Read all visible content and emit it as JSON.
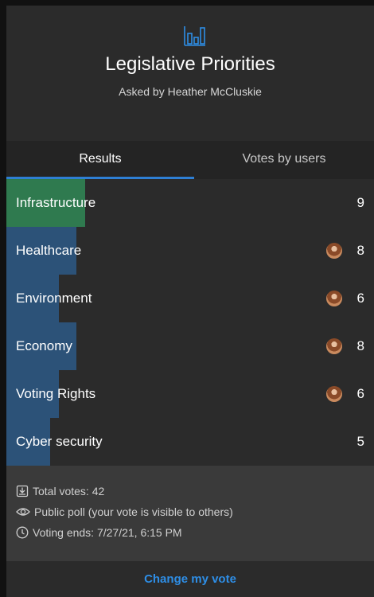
{
  "poll": {
    "title": "Legislative Priorities",
    "subtitle": "Asked by Heather McCluskie",
    "icon": "bar-chart-icon"
  },
  "tabs": [
    {
      "label": "Results",
      "active": true
    },
    {
      "label": "Votes by users",
      "active": false
    }
  ],
  "colors": {
    "accent": "#2e7fd4",
    "leading_bar": "#2f7a4f",
    "bar": "#2c5278",
    "link": "#2e8ee6"
  },
  "options": [
    {
      "label": "Infrastructure",
      "votes": "9",
      "share": 0.214,
      "leading": true,
      "avatar": false
    },
    {
      "label": "Healthcare",
      "votes": "8",
      "share": 0.19,
      "leading": false,
      "avatar": true
    },
    {
      "label": "Environment",
      "votes": "6",
      "share": 0.143,
      "leading": false,
      "avatar": true
    },
    {
      "label": "Economy",
      "votes": "8",
      "share": 0.19,
      "leading": false,
      "avatar": true
    },
    {
      "label": "Voting Rights",
      "votes": "6",
      "share": 0.143,
      "leading": false,
      "avatar": true
    },
    {
      "label": "Cyber security",
      "votes": "5",
      "share": 0.119,
      "leading": false,
      "avatar": false
    }
  ],
  "footer": {
    "total_votes": "Total votes: 42",
    "visibility": "Public poll (your vote is visible to others)",
    "ends": "Voting ends: 7/27/21, 6:15 PM"
  },
  "action": {
    "change_vote": "Change my vote"
  }
}
